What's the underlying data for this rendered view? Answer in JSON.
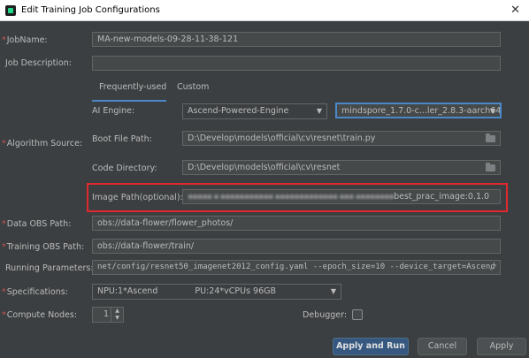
{
  "window": {
    "title": "Edit Training Job Configurations"
  },
  "labels": {
    "job_name": "JobName:",
    "job_description": "Job Description:",
    "ai_engine": "AI Engine:",
    "algorithm_source": "Algorithm Source:",
    "boot_file_path": "Boot File Path:",
    "code_directory": "Code Directory:",
    "image_path": "Image Path(optional):",
    "data_obs_path": "Data OBS Path:",
    "training_obs_path": "Training OBS Path:",
    "running_parameters": "Running Parameters:",
    "specifications": "Specifications:",
    "compute_nodes": "Compute Nodes:",
    "debugger": "Debugger:"
  },
  "tabs": [
    {
      "label": "Frequently-used",
      "active": true
    },
    {
      "label": "Custom",
      "active": false
    }
  ],
  "fields": {
    "job_name": "MA-new-models-09-28-11-38-121",
    "job_description": "",
    "boot_file_path": "D:\\Develop\\models\\official\\cv\\resnet\\train.py",
    "code_directory": "D:\\Develop\\models\\official\\cv\\resnet",
    "image_path_visible": "best_prac_image:0.1.0",
    "data_obs_path": "obs://data-flower/flower_photos/",
    "training_obs_path": "obs://data-flower/train/",
    "running_parameters": "net/config/resnet50_imagenet2012_config.yaml --epoch_size=10 --device_target=Ascend",
    "specifications_prefix": "NPU:1*Ascend",
    "specifications_suffix": "PU:24*vCPUs 96GB",
    "compute_nodes": "1"
  },
  "combos": {
    "ai_engine": "Ascend-Powered-Engine",
    "engine_version": "mindspore_1.7.0-c...ler_2.8.3-aarch64"
  },
  "buttons": {
    "apply_and_run": "Apply and Run",
    "cancel": "Cancel",
    "apply": "Apply"
  },
  "colors": {
    "background": "#3c3f41",
    "highlight_border": "#e0282e",
    "accent": "#4a88c7",
    "required_star": "#c75450"
  },
  "icons": {
    "close": "close-icon",
    "browse": "folder-icon",
    "dropdown": "chevron-down-icon",
    "expand": "expand-icon"
  }
}
